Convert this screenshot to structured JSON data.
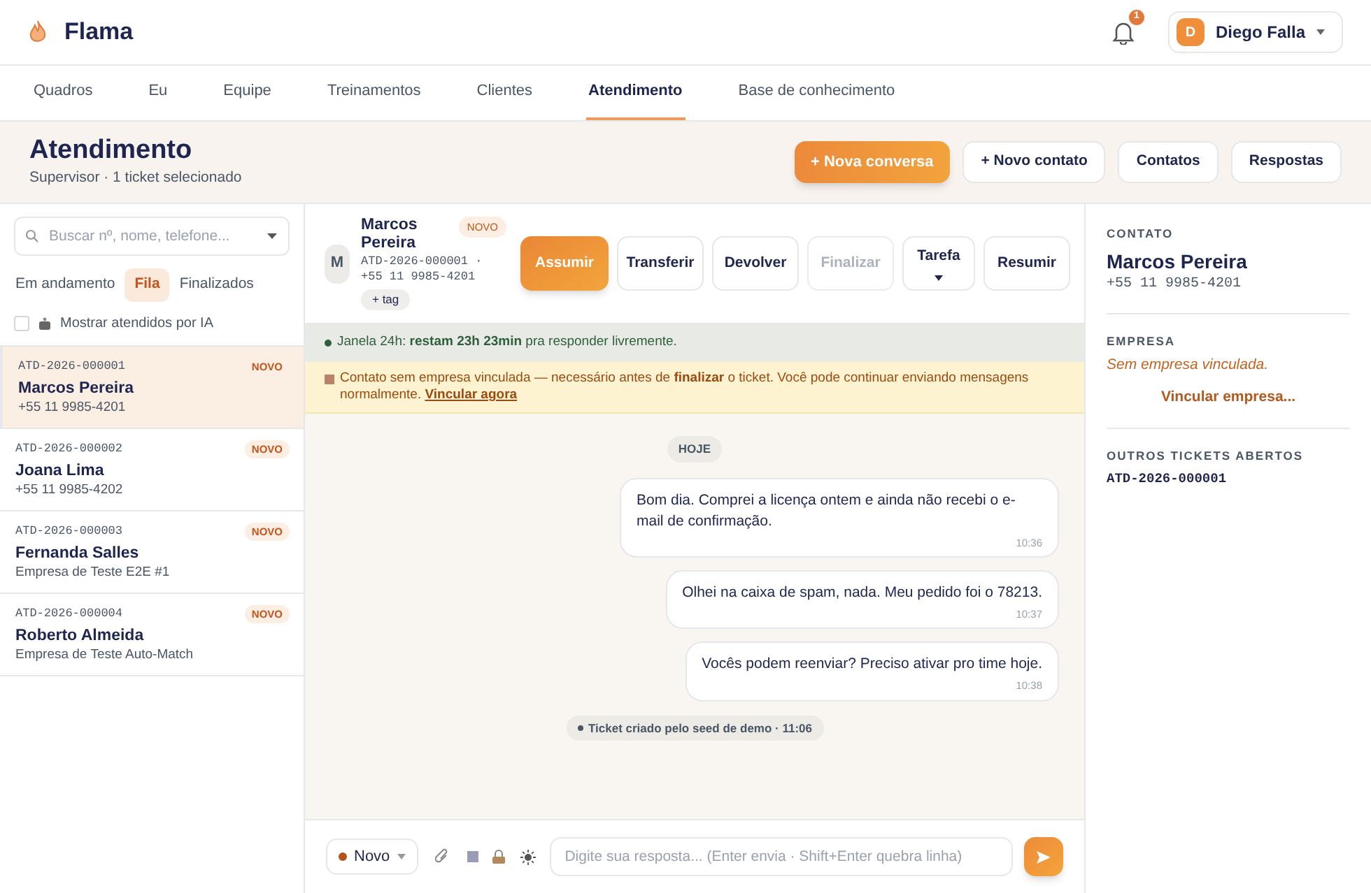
{
  "header": {
    "brand": "Flama",
    "notification_count": "1",
    "user": {
      "initial": "D",
      "name": "Diego Falla"
    }
  },
  "nav": [
    {
      "label": "Quadros",
      "selected": false
    },
    {
      "label": "Eu",
      "selected": false
    },
    {
      "label": "Equipe",
      "selected": false
    },
    {
      "label": "Treinamentos",
      "selected": false
    },
    {
      "label": "Clientes",
      "selected": false
    },
    {
      "label": "Atendimento",
      "selected": true
    },
    {
      "label": "Base de conhecimento",
      "selected": false
    }
  ],
  "page": {
    "title": "Atendimento",
    "subtitle": "Supervisor · 1 ticket selecionado",
    "actions": [
      {
        "label": "+ Nova conversa",
        "kind": "primary"
      },
      {
        "label": "+ Novo contato",
        "kind": "default"
      },
      {
        "label": "Contatos",
        "kind": "default"
      },
      {
        "label": "Respostas",
        "kind": "default"
      }
    ]
  },
  "queue": {
    "search": {
      "placeholder": "Buscar nº, nome, telefone..."
    },
    "filters": [
      {
        "label": "Em andamento",
        "selected": false
      },
      {
        "label": "Fila",
        "selected": true
      },
      {
        "label": "Finalizados",
        "selected": false
      }
    ],
    "ai_toggle": {
      "label": "Mostrar atendidos por IA",
      "checked": false
    },
    "tickets": [
      {
        "code": "ATD-2026-000001",
        "name": "Marcos Pereira",
        "detail": "+55 11 9985-4201",
        "badge": "NOVO",
        "selected": true
      },
      {
        "code": "ATD-2026-000002",
        "name": "Joana Lima",
        "detail": "+55 11 9985-4202",
        "badge": "NOVO",
        "selected": false
      },
      {
        "code": "ATD-2026-000003",
        "name": "Fernanda Salles",
        "detail": "Empresa de Teste E2E #1",
        "badge": "NOVO",
        "selected": false
      },
      {
        "code": "ATD-2026-000004",
        "name": "Roberto Almeida",
        "detail": "Empresa de Teste Auto-Match",
        "badge": "NOVO",
        "selected": false
      }
    ]
  },
  "conversation": {
    "contact": {
      "initial": "M",
      "name": "Marcos Pereira",
      "code_phone": "ATD-2026-000001 · +55 11 9985-4201",
      "badge": "NOVO",
      "tag_button": "+ tag"
    },
    "actions": [
      {
        "label": "Assumir",
        "kind": "primary",
        "disabled": false
      },
      {
        "label": "Transferir",
        "kind": "default",
        "disabled": false
      },
      {
        "label": "Devolver",
        "kind": "default",
        "disabled": false
      },
      {
        "label": "Finalizar",
        "kind": "default",
        "disabled": true
      },
      {
        "label": "Tarefa",
        "kind": "dropdown",
        "disabled": false
      },
      {
        "label": "Resumir",
        "kind": "default",
        "disabled": false
      }
    ],
    "window_notice": "Janela 24h: **restam 23h 23min** pra responder livremente.",
    "warning": {
      "text": "Contato sem empresa vinculada — necessário antes de **finalizar** o ticket. Você pode continuar enviando mensagens normalmente.",
      "link": "Vincular agora"
    },
    "date_label": "HOJE",
    "messages": [
      {
        "text": "Bom dia. Comprei a licença ontem e ainda não recebi o e-mail de confirmação.",
        "time": "10:36"
      },
      {
        "text": "Olhei na caixa de spam, nada. Meu pedido foi o 78213.",
        "time": "10:37"
      },
      {
        "text": "Vocês podem reenviar? Preciso ativar pro time hoje.",
        "time": "10:38"
      }
    ],
    "event": "Ticket criado pelo seed de demo · 11:06",
    "composer": {
      "status": {
        "label": "Novo",
        "color": "#b4531c"
      },
      "placeholder": "Digite sua resposta... (Enter envia · Shift+Enter quebra linha)"
    }
  },
  "details": {
    "contact_heading": "CONTATO",
    "contact_name": "Marcos Pereira",
    "contact_phone": "+55 11 9985-4201",
    "company_heading": "EMPRESA",
    "company_empty": "Sem empresa vinculada.",
    "link_company": "Vincular empresa...",
    "tickets_heading": "OUTROS TICKETS ABERTOS",
    "tickets": [
      "ATD-2026-000001"
    ]
  }
}
